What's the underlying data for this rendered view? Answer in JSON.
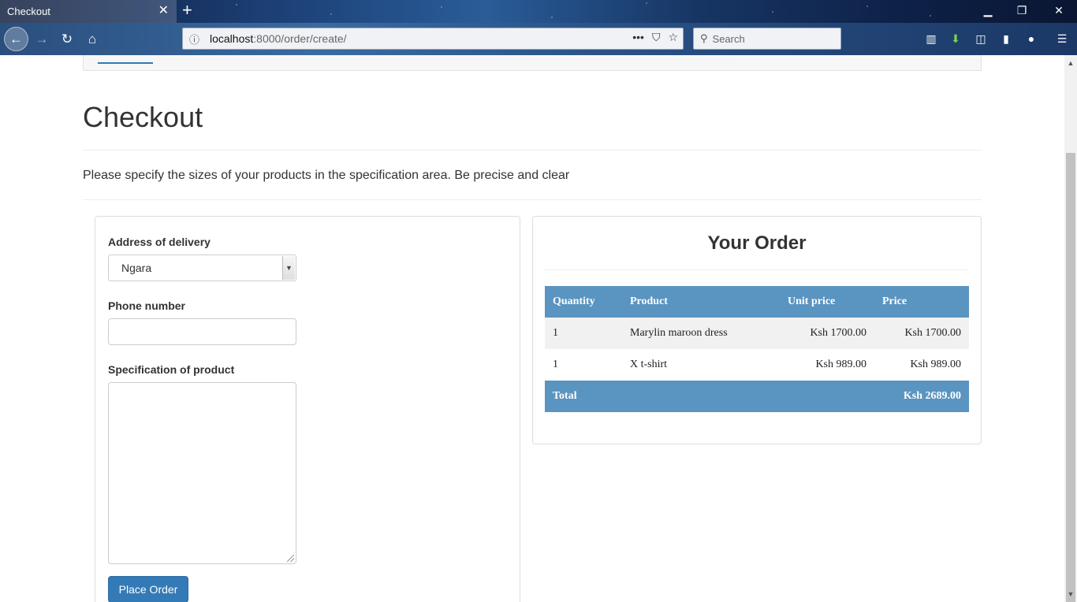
{
  "browser": {
    "tab_title": "Checkout",
    "tab_close": "✕",
    "new_tab": "+",
    "url_host": "localhost",
    "url_path": ":8000/order/create/",
    "search_placeholder": "Search"
  },
  "page": {
    "title": "Checkout",
    "intro": "Please specify the sizes of your products in the specification area. Be precise and clear"
  },
  "form": {
    "address_label": "Address of delivery",
    "address_value": "Ngara",
    "phone_label": "Phone number",
    "phone_value": "",
    "spec_label": "Specification of product",
    "spec_value": "",
    "submit_label": "Place Order",
    "primary_color": "#337ab7"
  },
  "order": {
    "heading": "Your Order",
    "columns": [
      "Quantity",
      "Product",
      "Unit price",
      "Price"
    ],
    "rows": [
      {
        "qty": "1",
        "product": "Marylin maroon dress",
        "unit_price": "Ksh 1700.00",
        "price": "Ksh 1700.00"
      },
      {
        "qty": "1",
        "product": "X t-shirt",
        "unit_price": "Ksh 989.00",
        "price": "Ksh 989.00"
      }
    ],
    "total_label": "Total",
    "total_value": "Ksh 2689.00",
    "header_color": "#5a94c0"
  }
}
